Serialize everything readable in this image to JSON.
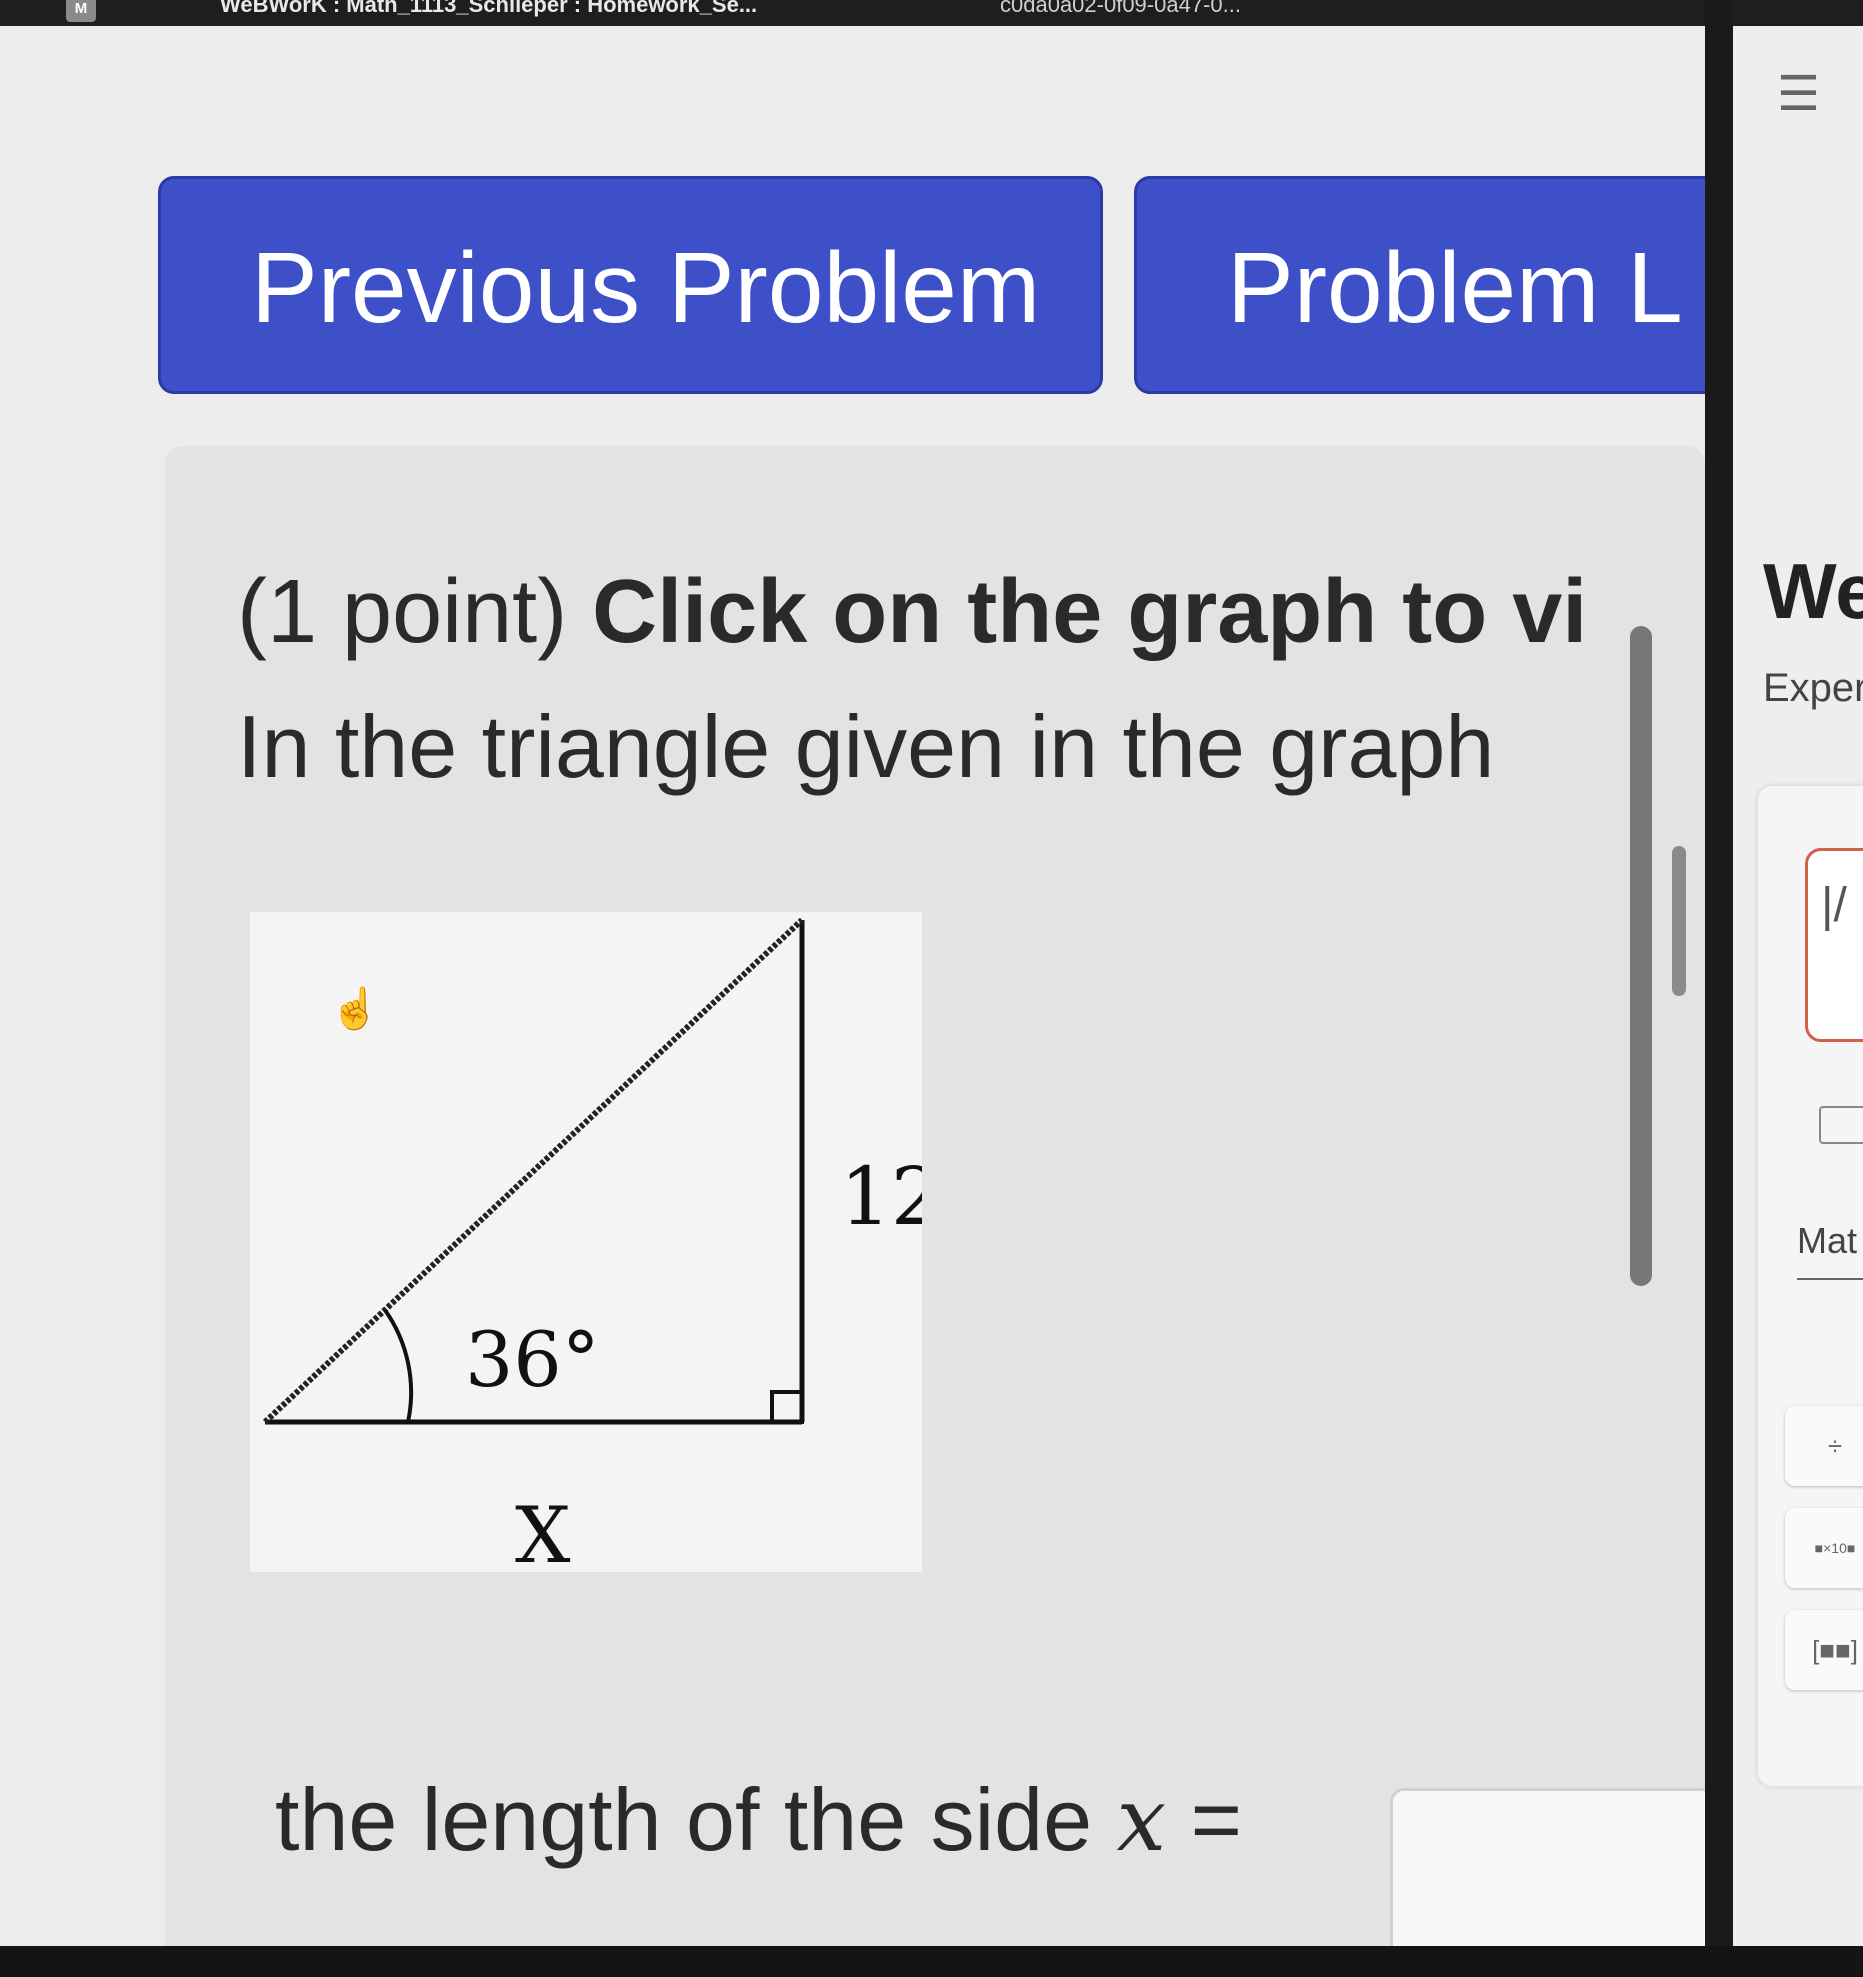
{
  "tab": {
    "favicon_letter": "M",
    "title": "WeBWorK : Math_1113_Schlieper : Homework_Se...",
    "title2": "c0da0a02-0f09-0a47-0..."
  },
  "nav": {
    "previous_label": "Previous Problem",
    "list_label": "Problem L"
  },
  "problem": {
    "points": "(1 point) ",
    "instruction_bold": "Click on the graph to vi",
    "statement": "In the triangle given in the graph",
    "graph": {
      "angle_label": "36°",
      "side_label": "12",
      "base_label": "X"
    },
    "answer_prefix": "the length of the side ",
    "answer_var": "x",
    "answer_eq": " =",
    "answer_value": ""
  },
  "side_panel": {
    "title": "We",
    "subtitle": "Exper",
    "input_text": "|/",
    "math_tab": "Mat",
    "buttons": [
      "÷",
      "■×10■",
      "[■■]"
    ]
  }
}
